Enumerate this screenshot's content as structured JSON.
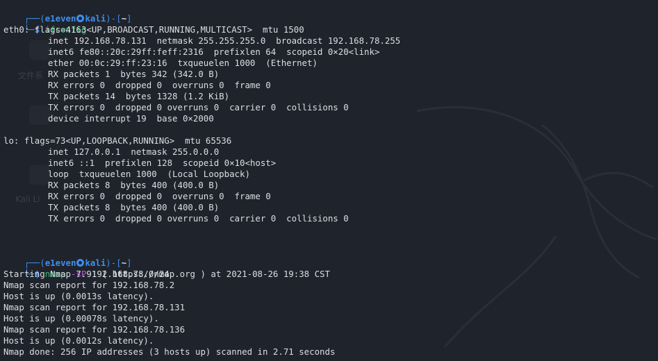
{
  "prompt": {
    "user": "e1even",
    "host": "kali",
    "dir": "~",
    "corner_top": "┌──(",
    "open_br": ")-[",
    "close_br": "]",
    "corner_bottom": "└─",
    "dollar": "$"
  },
  "commands": {
    "first": "ifconfig",
    "second_cmd": "nmap",
    "second_flag": "-sP",
    "second_arg": "192.168.78.0/24"
  },
  "ifconfig": {
    "eth0_header": "eth0: flags=4163<UP,BROADCAST,RUNNING,MULTICAST>  mtu 1500",
    "eth0_lines": [
      "inet 192.168.78.131  netmask 255.255.255.0  broadcast 192.168.78.255",
      "inet6 fe80::20c:29ff:feff:2316  prefixlen 64  scopeid 0×20<link>",
      "ether 00:0c:29:ff:23:16  txqueuelen 1000  (Ethernet)",
      "RX packets 1  bytes 342 (342.0 B)",
      "RX errors 0  dropped 0  overruns 0  frame 0",
      "TX packets 14  bytes 1328 (1.2 KiB)",
      "TX errors 0  dropped 0 overruns 0  carrier 0  collisions 0",
      "device interrupt 19  base 0×2000"
    ],
    "lo_header": "lo: flags=73<UP,LOOPBACK,RUNNING>  mtu 65536",
    "lo_lines": [
      "inet 127.0.0.1  netmask 255.0.0.0",
      "inet6 ::1  prefixlen 128  scopeid 0×10<host>",
      "loop  txqueuelen 1000  (Local Loopback)",
      "RX packets 8  bytes 400 (400.0 B)",
      "RX errors 0  dropped 0  overruns 0  frame 0",
      "TX packets 8  bytes 400 (400.0 B)",
      "TX errors 0  dropped 0 overruns 0  carrier 0  collisions 0"
    ]
  },
  "nmap_output": [
    "Starting Nmap 7.91 ( https://nmap.org ) at 2021-08-26 19:38 CST",
    "Nmap scan report for 192.168.78.2",
    "Host is up (0.0013s latency).",
    "Nmap scan report for 192.168.78.131",
    "Host is up (0.00078s latency).",
    "Nmap scan report for 192.168.78.136",
    "Host is up (0.0012s latency).",
    "Nmap done: 256 IP addresses (3 hosts up) scanned in 2.71 seconds"
  ],
  "desktop_ghost_labels": [
    "文件系",
    "Kali Li"
  ],
  "colors": {
    "background": "#1f232b",
    "prompt_blue": "#3d8ff0",
    "command_green": "#2fbf71",
    "flag_purple": "#b35dd6",
    "text": "#dcdfe4"
  }
}
